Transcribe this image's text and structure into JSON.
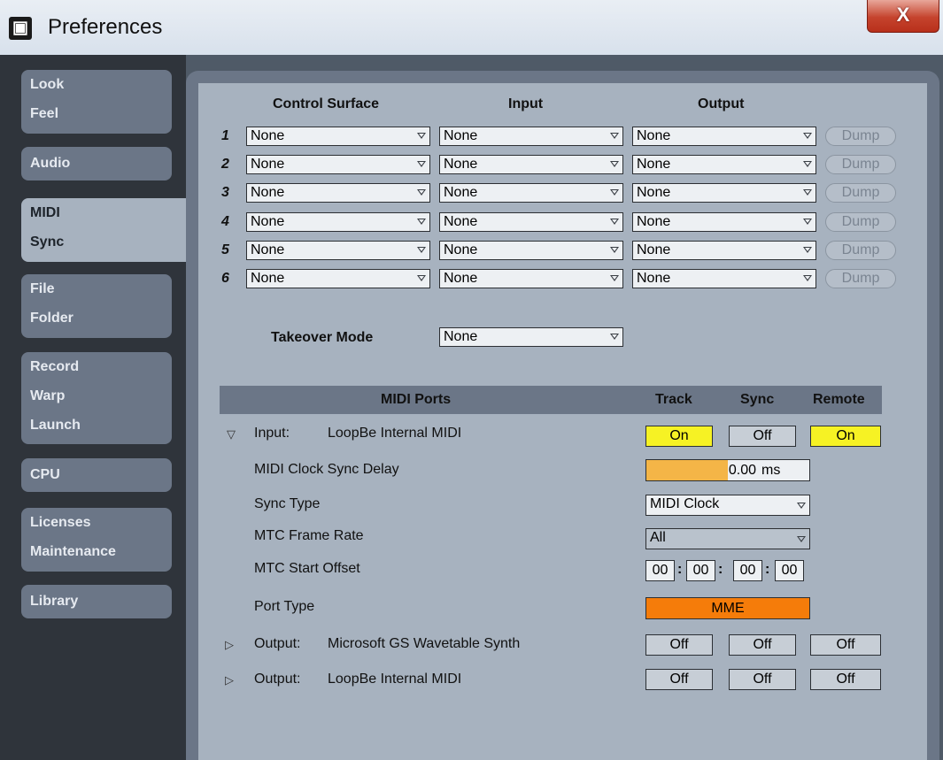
{
  "window": {
    "title": "Preferences",
    "close_glyph": "X"
  },
  "sidebar": {
    "tabs": [
      {
        "lines": [
          "Look",
          "Feel"
        ]
      },
      {
        "lines": [
          "Audio"
        ]
      },
      {
        "lines": [
          "MIDI",
          "Sync"
        ],
        "active": true
      },
      {
        "lines": [
          "File",
          "Folder"
        ]
      },
      {
        "lines": [
          "Record",
          "Warp",
          "Launch"
        ]
      },
      {
        "lines": [
          "CPU"
        ]
      },
      {
        "lines": [
          "Licenses",
          "Maintenance"
        ]
      },
      {
        "lines": [
          "Library"
        ]
      }
    ]
  },
  "surfaces": {
    "headers": {
      "control_surface": "Control Surface",
      "input": "Input",
      "output": "Output"
    },
    "rows": [
      {
        "num": "1",
        "control_surface": "None",
        "input": "None",
        "output": "None",
        "dump": "Dump"
      },
      {
        "num": "2",
        "control_surface": "None",
        "input": "None",
        "output": "None",
        "dump": "Dump"
      },
      {
        "num": "3",
        "control_surface": "None",
        "input": "None",
        "output": "None",
        "dump": "Dump"
      },
      {
        "num": "4",
        "control_surface": "None",
        "input": "None",
        "output": "None",
        "dump": "Dump"
      },
      {
        "num": "5",
        "control_surface": "None",
        "input": "None",
        "output": "None",
        "dump": "Dump"
      },
      {
        "num": "6",
        "control_surface": "None",
        "input": "None",
        "output": "None",
        "dump": "Dump"
      }
    ]
  },
  "takeover": {
    "label": "Takeover Mode",
    "value": "None"
  },
  "ports": {
    "headers": {
      "ports": "MIDI Ports",
      "track": "Track",
      "sync": "Sync",
      "remote": "Remote"
    },
    "input": {
      "prefix": "Input:",
      "name": "LoopBe Internal MIDI",
      "track": "On",
      "sync": "Off",
      "remote": "On",
      "clock_delay": {
        "label": "MIDI Clock Sync Delay",
        "value": "0.00",
        "unit": "ms",
        "fill_fraction": 0.5
      },
      "sync_type": {
        "label": "Sync Type",
        "value": "MIDI Clock"
      },
      "mtc_frame_rate": {
        "label": "MTC Frame Rate",
        "value": "All"
      },
      "mtc_start_offset": {
        "label": "MTC Start Offset",
        "values": [
          "00",
          "00",
          "00",
          "00"
        ],
        "separator": ":"
      },
      "port_type": {
        "label": "Port Type",
        "value": "MME"
      }
    },
    "outputs": [
      {
        "prefix": "Output:",
        "name": "Microsoft GS Wavetable Synth",
        "track": "Off",
        "sync": "Off",
        "remote": "Off"
      },
      {
        "prefix": "Output:",
        "name": "LoopBe Internal MIDI",
        "track": "Off",
        "sync": "Off",
        "remote": "Off"
      }
    ]
  },
  "icons": {
    "expanded": "expanded-triangle-icon",
    "collapsed": "collapsed-triangle-icon",
    "dropdown": "dropdown-arrow-icon"
  }
}
